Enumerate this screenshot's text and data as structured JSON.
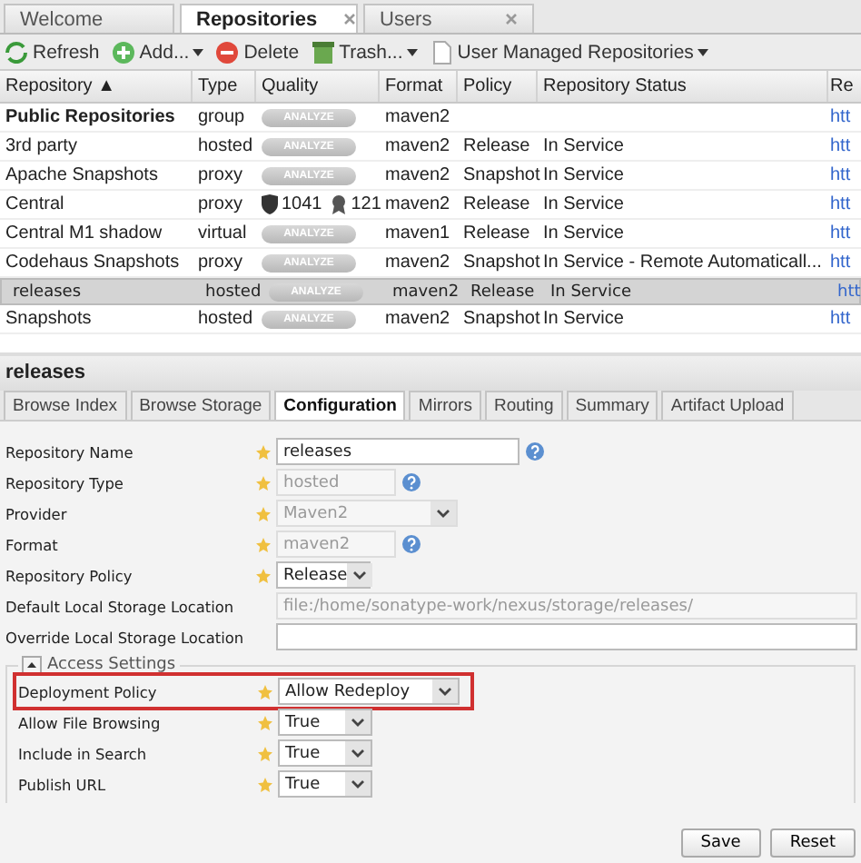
{
  "tabs": [
    {
      "label": "Welcome",
      "selected": false,
      "closable": false
    },
    {
      "label": "Repositories",
      "selected": true,
      "closable": true
    },
    {
      "label": "Users",
      "selected": false,
      "closable": true
    }
  ],
  "toolbar": [
    {
      "label": "Refresh",
      "menu": false
    },
    {
      "label": "Add...",
      "menu": true
    },
    {
      "label": "Delete",
      "menu": false
    },
    {
      "label": "Trash...",
      "menu": true
    },
    {
      "label": "User Managed Repositories",
      "menu": true
    }
  ],
  "table": {
    "columns": [
      "Repository ▲",
      "Type",
      "Quality",
      "Format",
      "Policy",
      "Repository Status",
      "Re"
    ],
    "rows": [
      {
        "repository": "Public Repositories",
        "bold": true,
        "type": "group",
        "quality": {
          "kind": "analyze",
          "label": "ANALYZE"
        },
        "format": "maven2",
        "column_7": "htt",
        "selected": false
      },
      {
        "repository": "3rd party",
        "bold": false,
        "type": "hosted",
        "quality": {
          "kind": "analyze",
          "label": "ANALYZE"
        },
        "format": "maven2",
        "policy": "Release",
        "status": "In Service",
        "column_7": "htt",
        "selected": false
      },
      {
        "repository": "Apache Snapshots",
        "bold": false,
        "type": "proxy",
        "quality": {
          "kind": "analyze",
          "label": "ANALYZE"
        },
        "format": "maven2",
        "policy": "Snapshot",
        "status": "In Service",
        "column_7": "htt",
        "selected": false
      },
      {
        "repository": "Central",
        "bold": false,
        "type": "proxy",
        "quality": {
          "kind": "counts",
          "security": "1041",
          "license": "121"
        },
        "format": "maven2",
        "policy": "Release",
        "status": "In Service",
        "column_7": "htt",
        "selected": false
      },
      {
        "repository": "Central M1 shadow",
        "bold": false,
        "type": "virtual",
        "quality": {
          "kind": "analyze",
          "label": "ANALYZE"
        },
        "format": "maven1",
        "policy": "Release",
        "status": "In Service",
        "column_7": "htt",
        "selected": false
      },
      {
        "repository": "Codehaus Snapshots",
        "bold": false,
        "type": "proxy",
        "quality": {
          "kind": "analyze",
          "label": "ANALYZE"
        },
        "format": "maven2",
        "policy": "Snapshot",
        "status": "In Service - Remote Automaticall...",
        "column_7": "htt",
        "selected": false
      },
      {
        "repository": "releases",
        "bold": false,
        "type": "hosted",
        "quality": {
          "kind": "analyze",
          "label": "ANALYZE"
        },
        "format": "maven2",
        "policy": "Release",
        "status": "In Service",
        "column_7": "htt",
        "selected": true
      },
      {
        "repository": "Snapshots",
        "bold": false,
        "type": "hosted",
        "quality": {
          "kind": "analyze",
          "label": "ANALYZE"
        },
        "format": "maven2",
        "policy": "Snapshot",
        "status": "In Service",
        "column_7": "htt",
        "selected": false
      }
    ]
  },
  "panel": {
    "title": "releases",
    "tabs": [
      {
        "label": "Browse Index",
        "selected": false
      },
      {
        "label": "Browse Storage",
        "selected": false
      },
      {
        "label": "Configuration",
        "selected": true
      },
      {
        "label": "Mirrors",
        "selected": false
      },
      {
        "label": "Routing",
        "selected": false
      },
      {
        "label": "Summary",
        "selected": false
      },
      {
        "label": "Artifact Upload",
        "selected": false
      }
    ],
    "fields": [
      {
        "label": "Repository Name",
        "kind": "text",
        "value": "releases",
        "disabled": false,
        "required": true,
        "help": true
      },
      {
        "label": "Repository Type",
        "kind": "text",
        "value": "hosted",
        "disabled": true,
        "required": true,
        "help": true
      },
      {
        "label": "Provider",
        "kind": "select",
        "value": "Maven2",
        "disabled": true,
        "required": true,
        "help": false
      },
      {
        "label": "Format",
        "kind": "text",
        "value": "maven2",
        "disabled": true,
        "required": true,
        "help": true
      },
      {
        "label": "Repository Policy",
        "kind": "select",
        "value": "Release",
        "disabled": false,
        "required": true,
        "help": false
      },
      {
        "label": "Default Local Storage Location",
        "kind": "text",
        "value": "file:/home/sonatype-work/nexus/storage/releases/",
        "disabled": true,
        "required": false,
        "help": false
      },
      {
        "label": "Override Local Storage Location",
        "kind": "text",
        "disabled": false,
        "required": false,
        "help": false
      }
    ],
    "section": {
      "title": "Access Settings",
      "expanded": true,
      "fields": [
        {
          "label": "Deployment Policy",
          "kind": "select",
          "value": "Allow Redeploy",
          "highlighted": true,
          "required": true
        },
        {
          "label": "Allow File Browsing",
          "kind": "select",
          "value": "True",
          "highlighted": false,
          "required": true
        },
        {
          "label": "Include in Search",
          "kind": "select",
          "value": "True",
          "highlighted": false,
          "required": true
        },
        {
          "label": "Publish URL",
          "kind": "select",
          "value": "True",
          "highlighted": false,
          "required": true
        }
      ]
    },
    "buttons": [
      "Save",
      "Reset"
    ]
  }
}
